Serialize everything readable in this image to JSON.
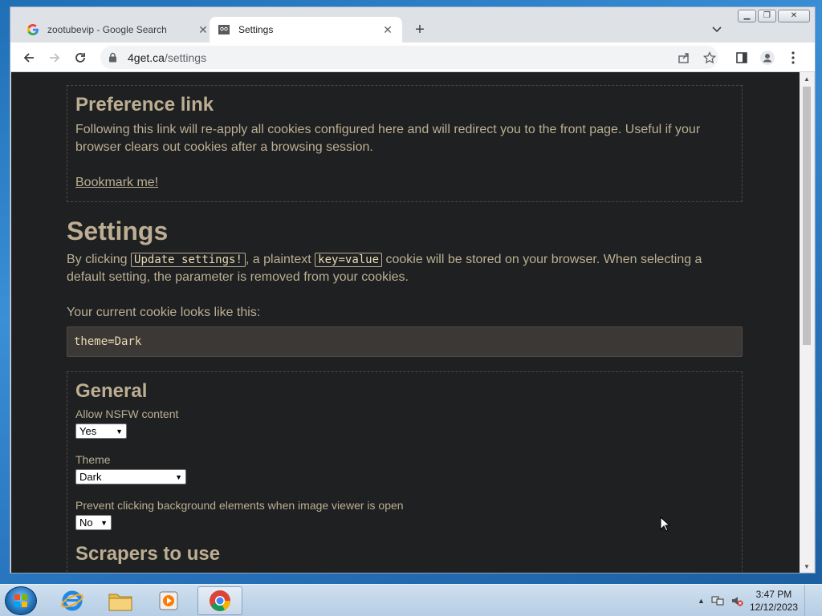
{
  "browser": {
    "tabs": [
      {
        "title": "zootubevip - Google Search",
        "favicon": "google-icon",
        "active": false
      },
      {
        "title": "Settings",
        "favicon": "4get-icon",
        "active": true
      }
    ],
    "address": {
      "host": "4get.ca",
      "path": "/settings"
    }
  },
  "page": {
    "preference": {
      "heading": "Preference link",
      "text": "Following this link will re-apply all cookies configured here and will redirect you to the front page. Useful if your browser clears out cookies after a browsing session.",
      "link": "Bookmark me!"
    },
    "settings": {
      "heading": "Settings",
      "intro_1": "By clicking ",
      "code_1": "Update settings!",
      "intro_2": ", a plaintext ",
      "code_2": "key=value",
      "intro_3": " cookie will be stored on your browser. When selecting a default setting, the parameter is removed from your cookies.",
      "cookie_label": "Your current cookie looks like this:",
      "cookie_value": "theme=Dark"
    },
    "general": {
      "heading": "General",
      "fields": [
        {
          "label": "Allow NSFW content",
          "value": "Yes"
        },
        {
          "label": "Theme",
          "value": "Dark"
        },
        {
          "label": "Prevent clicking background elements when image viewer is open",
          "value": "No"
        }
      ]
    },
    "scrapers_heading": "Scrapers to use"
  },
  "taskbar": {
    "time": "3:47 PM",
    "date": "12/12/2023"
  },
  "colors": {
    "page_bg": "#1e2021",
    "text": "#bdae93",
    "code_bg": "#3c3836"
  }
}
